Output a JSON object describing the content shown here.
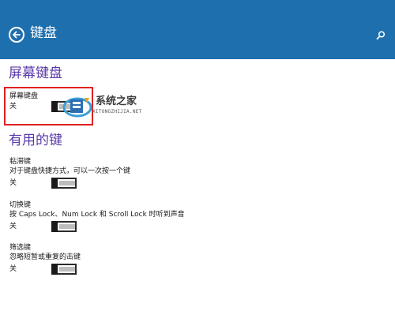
{
  "header": {
    "title": "键盘",
    "back_icon": "back-arrow-icon",
    "search_icon": "search-icon",
    "background": "#1e6fae"
  },
  "sections": {
    "onscreen": {
      "title": "屏幕键盘",
      "item": {
        "name": "屏幕键盘",
        "state": "关",
        "on": false
      }
    },
    "useful_keys": {
      "title": "有用的键",
      "sticky": {
        "name": "粘滞键",
        "desc": "对于键盘快捷方式，可以一次按一个键",
        "state": "关",
        "on": false
      },
      "toggle_keys": {
        "name": "切换键",
        "desc": "按 Caps Lock、Num Lock 和 Scroll Lock 时听到声音",
        "state": "关",
        "on": false
      },
      "filter": {
        "name": "筛选键",
        "desc": "忽略短暂或重复的击键",
        "state": "关",
        "on": false
      }
    }
  },
  "watermark": {
    "text": "系统之家",
    "sub": "XITONGZHIJIA.NET"
  },
  "colors": {
    "section_title": "#5a3aa8",
    "highlight": "#e02020"
  }
}
